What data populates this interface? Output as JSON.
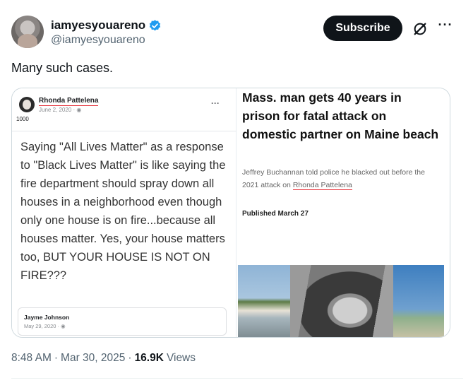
{
  "author": {
    "display_name": "iamyesyouareno",
    "handle": "@iamyesyouareno",
    "verified": true
  },
  "actions": {
    "subscribe_label": "Subscribe",
    "grok_icon": "grok-icon",
    "more_icon": "more-icon",
    "more_glyph": "···"
  },
  "tweet": {
    "text": "Many such cases."
  },
  "media": {
    "left": {
      "poster_name": "Rhonda Pattelena",
      "poster_date": "June 2, 2020 · ",
      "count": "1000",
      "dots": "···",
      "quote": "Saying \"All Lives Matter\" as a response to \"Black Lives Matter\" is like saying the fire department should spray down all houses in a neighborhood even though only one house is on fire...because all houses matter. Yes, your house matters too, BUT YOUR HOUSE IS NOT ON FIRE???",
      "sub_name": "Jayme Johnson",
      "sub_date": "May 29, 2020 · "
    },
    "right": {
      "headline": "Mass. man gets 40 years in prison for fatal attack on domestic partner on Maine beach",
      "dek_prefix": "Jeffrey Buchannan told police he blacked out before the 2021 attack on ",
      "dek_highlight": "Rhonda Pattelena",
      "published": "Published March 27"
    }
  },
  "meta": {
    "time": "8:48 AM",
    "sep1": "·",
    "date": "Mar 30, 2025",
    "sep2": "·",
    "views_count": "16.9K",
    "views_label": "Views"
  },
  "colors": {
    "verified_badge": "#1d9bf0",
    "subscribe_bg": "#0f1419",
    "underline_red": "#e5323a"
  }
}
